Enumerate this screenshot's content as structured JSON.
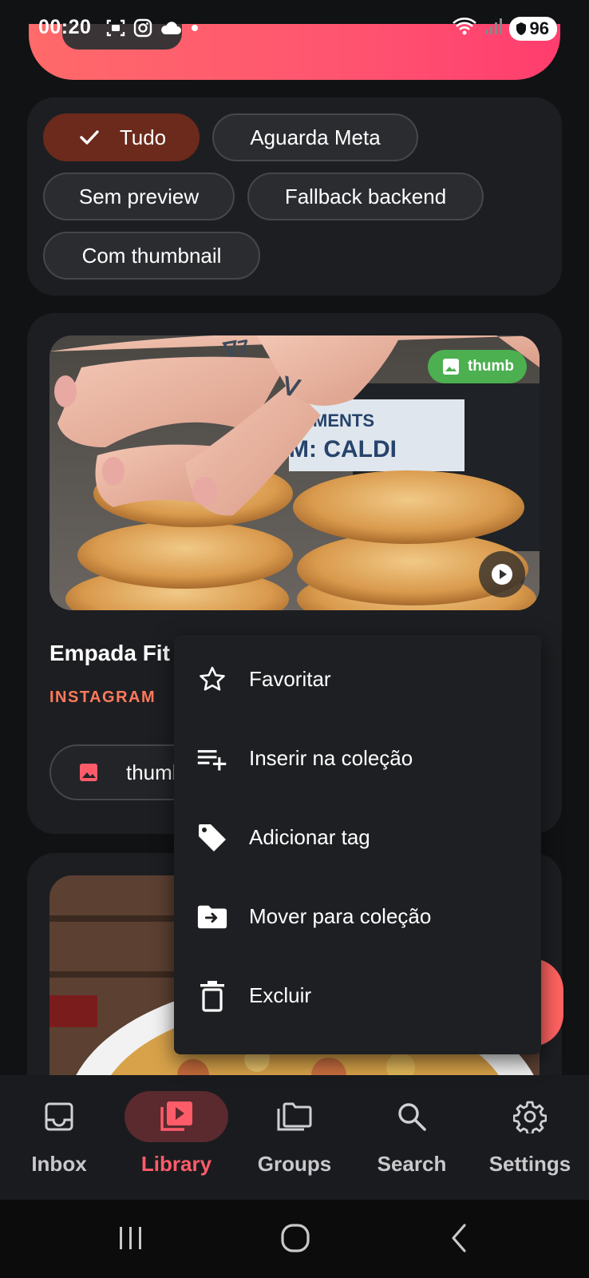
{
  "status_bar": {
    "time": "00:20",
    "battery": "96",
    "icons": [
      "screenshot-icon",
      "instagram-icon",
      "cloud-icon",
      "dot-icon",
      "wifi-icon",
      "signal-icon",
      "battery-icon"
    ]
  },
  "filters": {
    "chips": [
      {
        "label": "Tudo",
        "selected": true
      },
      {
        "label": "Aguarda Meta",
        "selected": false
      },
      {
        "label": "Sem preview",
        "selected": false
      },
      {
        "label": "Fallback backend",
        "selected": false
      },
      {
        "label": "Com thumbnail",
        "selected": false
      }
    ]
  },
  "post": {
    "badge": "thumb",
    "title": "Empada Fit",
    "source": "INSTAGRAM",
    "pill_label": "thumbnail"
  },
  "context_menu": {
    "items": [
      {
        "label": "Favoritar",
        "icon": "star-outline-icon"
      },
      {
        "label": "Inserir na coleção",
        "icon": "playlist-add-icon"
      },
      {
        "label": "Adicionar tag",
        "icon": "tag-icon"
      },
      {
        "label": "Mover para coleção",
        "icon": "folder-move-icon"
      },
      {
        "label": "Excluir",
        "icon": "trash-icon"
      }
    ]
  },
  "bottom_nav": {
    "items": [
      {
        "label": "Inbox",
        "icon": "inbox-icon",
        "active": false
      },
      {
        "label": "Library",
        "icon": "video-library-icon",
        "active": true
      },
      {
        "label": "Groups",
        "icon": "folders-icon",
        "active": false
      },
      {
        "label": "Search",
        "icon": "search-icon",
        "active": false
      },
      {
        "label": "Settings",
        "icon": "gear-icon",
        "active": false
      }
    ]
  },
  "colors": {
    "background": "#111214",
    "card": "#1d1e21",
    "accent": "#ff5c6a",
    "selected_chip": "#6b2a1b",
    "source_text": "#ff7a5c",
    "thumb_badge": "#4caf50"
  }
}
